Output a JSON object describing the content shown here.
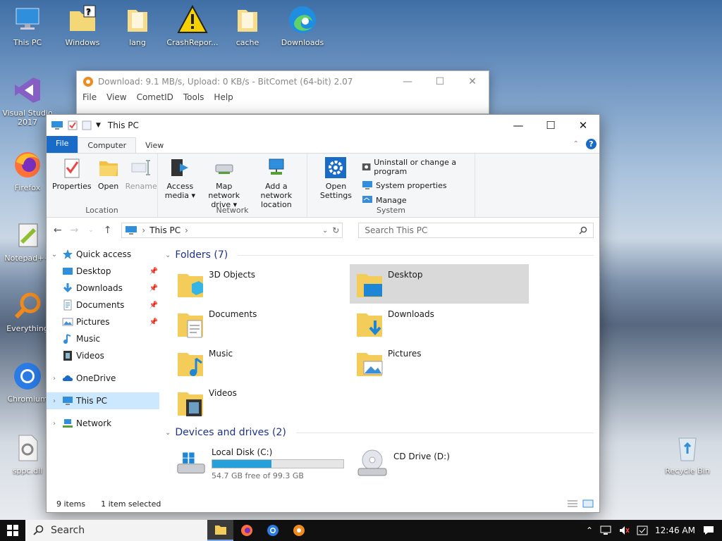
{
  "desktop": {
    "icons": [
      {
        "label": "This PC"
      },
      {
        "label": "Windows"
      },
      {
        "label": "lang"
      },
      {
        "label": "CrashRepor..."
      },
      {
        "label": "cache"
      },
      {
        "label": "Downloads"
      },
      {
        "label": "Visual Studio 2017"
      },
      {
        "label": "Firefox"
      },
      {
        "label": "Notepad++"
      },
      {
        "label": "Everything"
      },
      {
        "label": "Chromium"
      },
      {
        "label": "sppc.dll"
      },
      {
        "label": "Recycle Bin"
      }
    ]
  },
  "bitcomet": {
    "title": "Download: 9.1 MB/s, Upload: 0 KB/s - BitComet (64-bit) 2.07",
    "menu": [
      "File",
      "View",
      "CometID",
      "Tools",
      "Help"
    ]
  },
  "explorer": {
    "title": "This PC",
    "tabs": {
      "file": "File",
      "computer": "Computer",
      "view": "View"
    },
    "ribbon": {
      "location": {
        "label": "Location",
        "properties": "Properties",
        "open": "Open",
        "rename": "Rename"
      },
      "network": {
        "label": "Network",
        "access_media": "Access media ▾",
        "map_drive": "Map network drive ▾",
        "add_location": "Add a network location"
      },
      "system": {
        "label": "System",
        "open_settings": "Open Settings",
        "uninstall": "Uninstall or change a program",
        "sys_props": "System properties",
        "manage": "Manage"
      }
    },
    "address": {
      "crumb": "This PC"
    },
    "search": {
      "placeholder": "Search This PC"
    },
    "nav": {
      "quick_access": "Quick access",
      "items": [
        "Desktop",
        "Downloads",
        "Documents",
        "Pictures",
        "Music",
        "Videos"
      ],
      "onedrive": "OneDrive",
      "this_pc": "This PC",
      "network": "Network"
    },
    "folders": {
      "header": "Folders (7)",
      "items": [
        "3D Objects",
        "Desktop",
        "Documents",
        "Downloads",
        "Music",
        "Pictures",
        "Videos"
      ]
    },
    "drives": {
      "header": "Devices and drives (2)",
      "c": {
        "name": "Local Disk (C:)",
        "free": "54.7 GB free of 99.3 GB",
        "used_fraction": 0.449
      },
      "d": {
        "name": "CD Drive (D:)"
      }
    },
    "status": {
      "count": "9 items",
      "selected": "1 item selected"
    }
  },
  "taskbar": {
    "search": "Search",
    "time": "12:46 AM"
  },
  "colors": {
    "accent": "#1a6ac7",
    "selection": "#cce8ff",
    "drive_fill": "#26a0da"
  }
}
